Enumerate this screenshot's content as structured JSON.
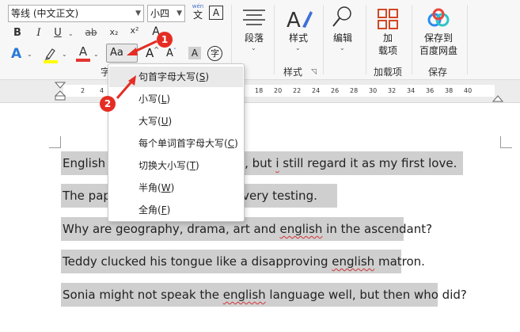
{
  "font": {
    "name_value": "等线 (中文正文)",
    "size_value": "小四",
    "pinyin_top": "wén",
    "pinyin_char": "文",
    "border_char": "A"
  },
  "format": {
    "bold": "B",
    "italic": "I",
    "underline": "U",
    "strike": "ab",
    "subscript": "x₂",
    "superscript": "x²",
    "clear": "A"
  },
  "row3": {
    "effects": "A",
    "font_color": "A",
    "change_case": "Aa",
    "grow": "A",
    "shrink": "A",
    "shading": "A",
    "enclose": "字"
  },
  "groups": {
    "font_group_fragment": "字",
    "paragraph": "段落",
    "styles_button": "样式",
    "styles_group": "样式",
    "editing": "编辑",
    "add_line1": "加",
    "add_line2": "载项",
    "addins_group": "加载项",
    "save_line1": "保存到",
    "save_line2": "百度网盘",
    "save_group": "保存"
  },
  "ruler": {
    "ticks": [
      "2",
      "4",
      "18",
      "20",
      "22",
      "24",
      "26",
      "28",
      "30",
      "32",
      "34",
      "36",
      "38",
      "40"
    ]
  },
  "menu": {
    "items": [
      {
        "text": "句首字母大写(",
        "key": "S",
        "end": ")"
      },
      {
        "text": "小写(",
        "key": "L",
        "end": ")"
      },
      {
        "text": "大写(",
        "key": "U",
        "end": ")"
      },
      {
        "text": "每个单词首字母大写(",
        "key": "C",
        "end": ")"
      },
      {
        "text": "切换大小写(",
        "key": "T",
        "end": ")"
      },
      {
        "text": "半角(",
        "key": "W",
        "end": ")"
      },
      {
        "text": "全角(",
        "key": "F",
        "end": ")"
      }
    ]
  },
  "badges": {
    "one": "1",
    "two": "2"
  },
  "doc": {
    "line1_a": "English h",
    "line1_b": "mes, but ",
    "line1_c": "i",
    "line1_d": " still regard it as my first love.",
    "line2_a": "The pape",
    "line2_b": "are very testing.",
    "line3_a": "Why are geography, drama, art and ",
    "line3_b": "english",
    "line3_c": " in the ascendant?",
    "line4_a": "Teddy clucked his tongue like a disapproving ",
    "line4_b": "english",
    "line4_c": " matron.",
    "line5_a": "Sonia might not speak the ",
    "line5_b": "english",
    "line5_c": " language well, but then who did?"
  },
  "colors": {
    "accent_red": "#e52d24",
    "highlight_yellow": "#ffff00",
    "font_red": "#e3342f",
    "selection_gray": "#cfcfcf",
    "addin_orange": "#d24726"
  },
  "icons": [
    "chevron-down-icon",
    "pinyin-guide-icon",
    "char-border-icon",
    "text-effects-icon",
    "highlighter-icon",
    "font-color-icon",
    "change-case-icon",
    "grow-font-icon",
    "shrink-font-icon",
    "char-shading-icon",
    "enclosed-char-icon",
    "paragraph-icon",
    "styles-icon",
    "find-icon",
    "addins-icon",
    "baidu-cloud-icon",
    "dialog-launcher-icon",
    "arrow-icon"
  ]
}
